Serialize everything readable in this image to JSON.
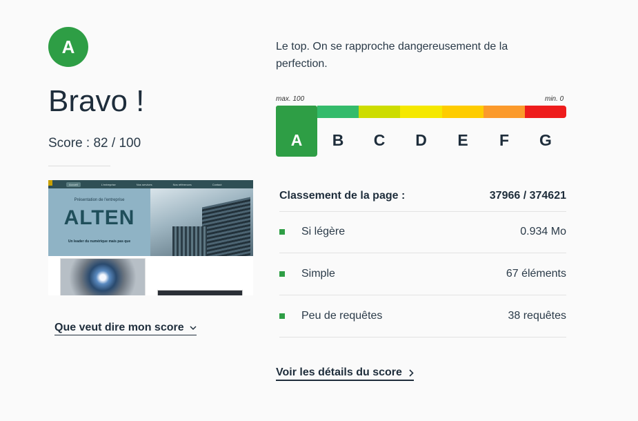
{
  "grade": {
    "letter": "A",
    "color": "#2e9e45"
  },
  "headline": "Bravo !",
  "score_text": "Score : 82 / 100",
  "description": "Le top. On se rapproche dangereusement de la perfection.",
  "scale": {
    "max_label": "max. 100",
    "min_label": "min. 0",
    "active": "A",
    "grades": [
      {
        "letter": "A",
        "color": "#2e9e45"
      },
      {
        "letter": "B",
        "color": "#34bb6b"
      },
      {
        "letter": "C",
        "color": "#cddc00"
      },
      {
        "letter": "D",
        "color": "#f5e800"
      },
      {
        "letter": "E",
        "color": "#fecc00"
      },
      {
        "letter": "F",
        "color": "#fb9a2b"
      },
      {
        "letter": "G",
        "color": "#ee1c1c"
      }
    ]
  },
  "thumbnail": {
    "nav": [
      "Accueil",
      "L'entreprise",
      "Nos services",
      "Nos références",
      "Contact"
    ],
    "kicker": "Présentation de l'entreprise",
    "brand": "ALTEN",
    "tagline": "Un leader du numérique mais pas que"
  },
  "explain_link": "Que veut dire mon score",
  "ranking": {
    "label": "Classement de la page :",
    "value": "37966 / 374621"
  },
  "metrics": [
    {
      "label": "Si légère",
      "value": "0.934 Mo"
    },
    {
      "label": "Simple",
      "value": "67 éléments"
    },
    {
      "label": "Peu de requêtes",
      "value": "38 requêtes"
    }
  ],
  "details_link": "Voir les détails du score"
}
